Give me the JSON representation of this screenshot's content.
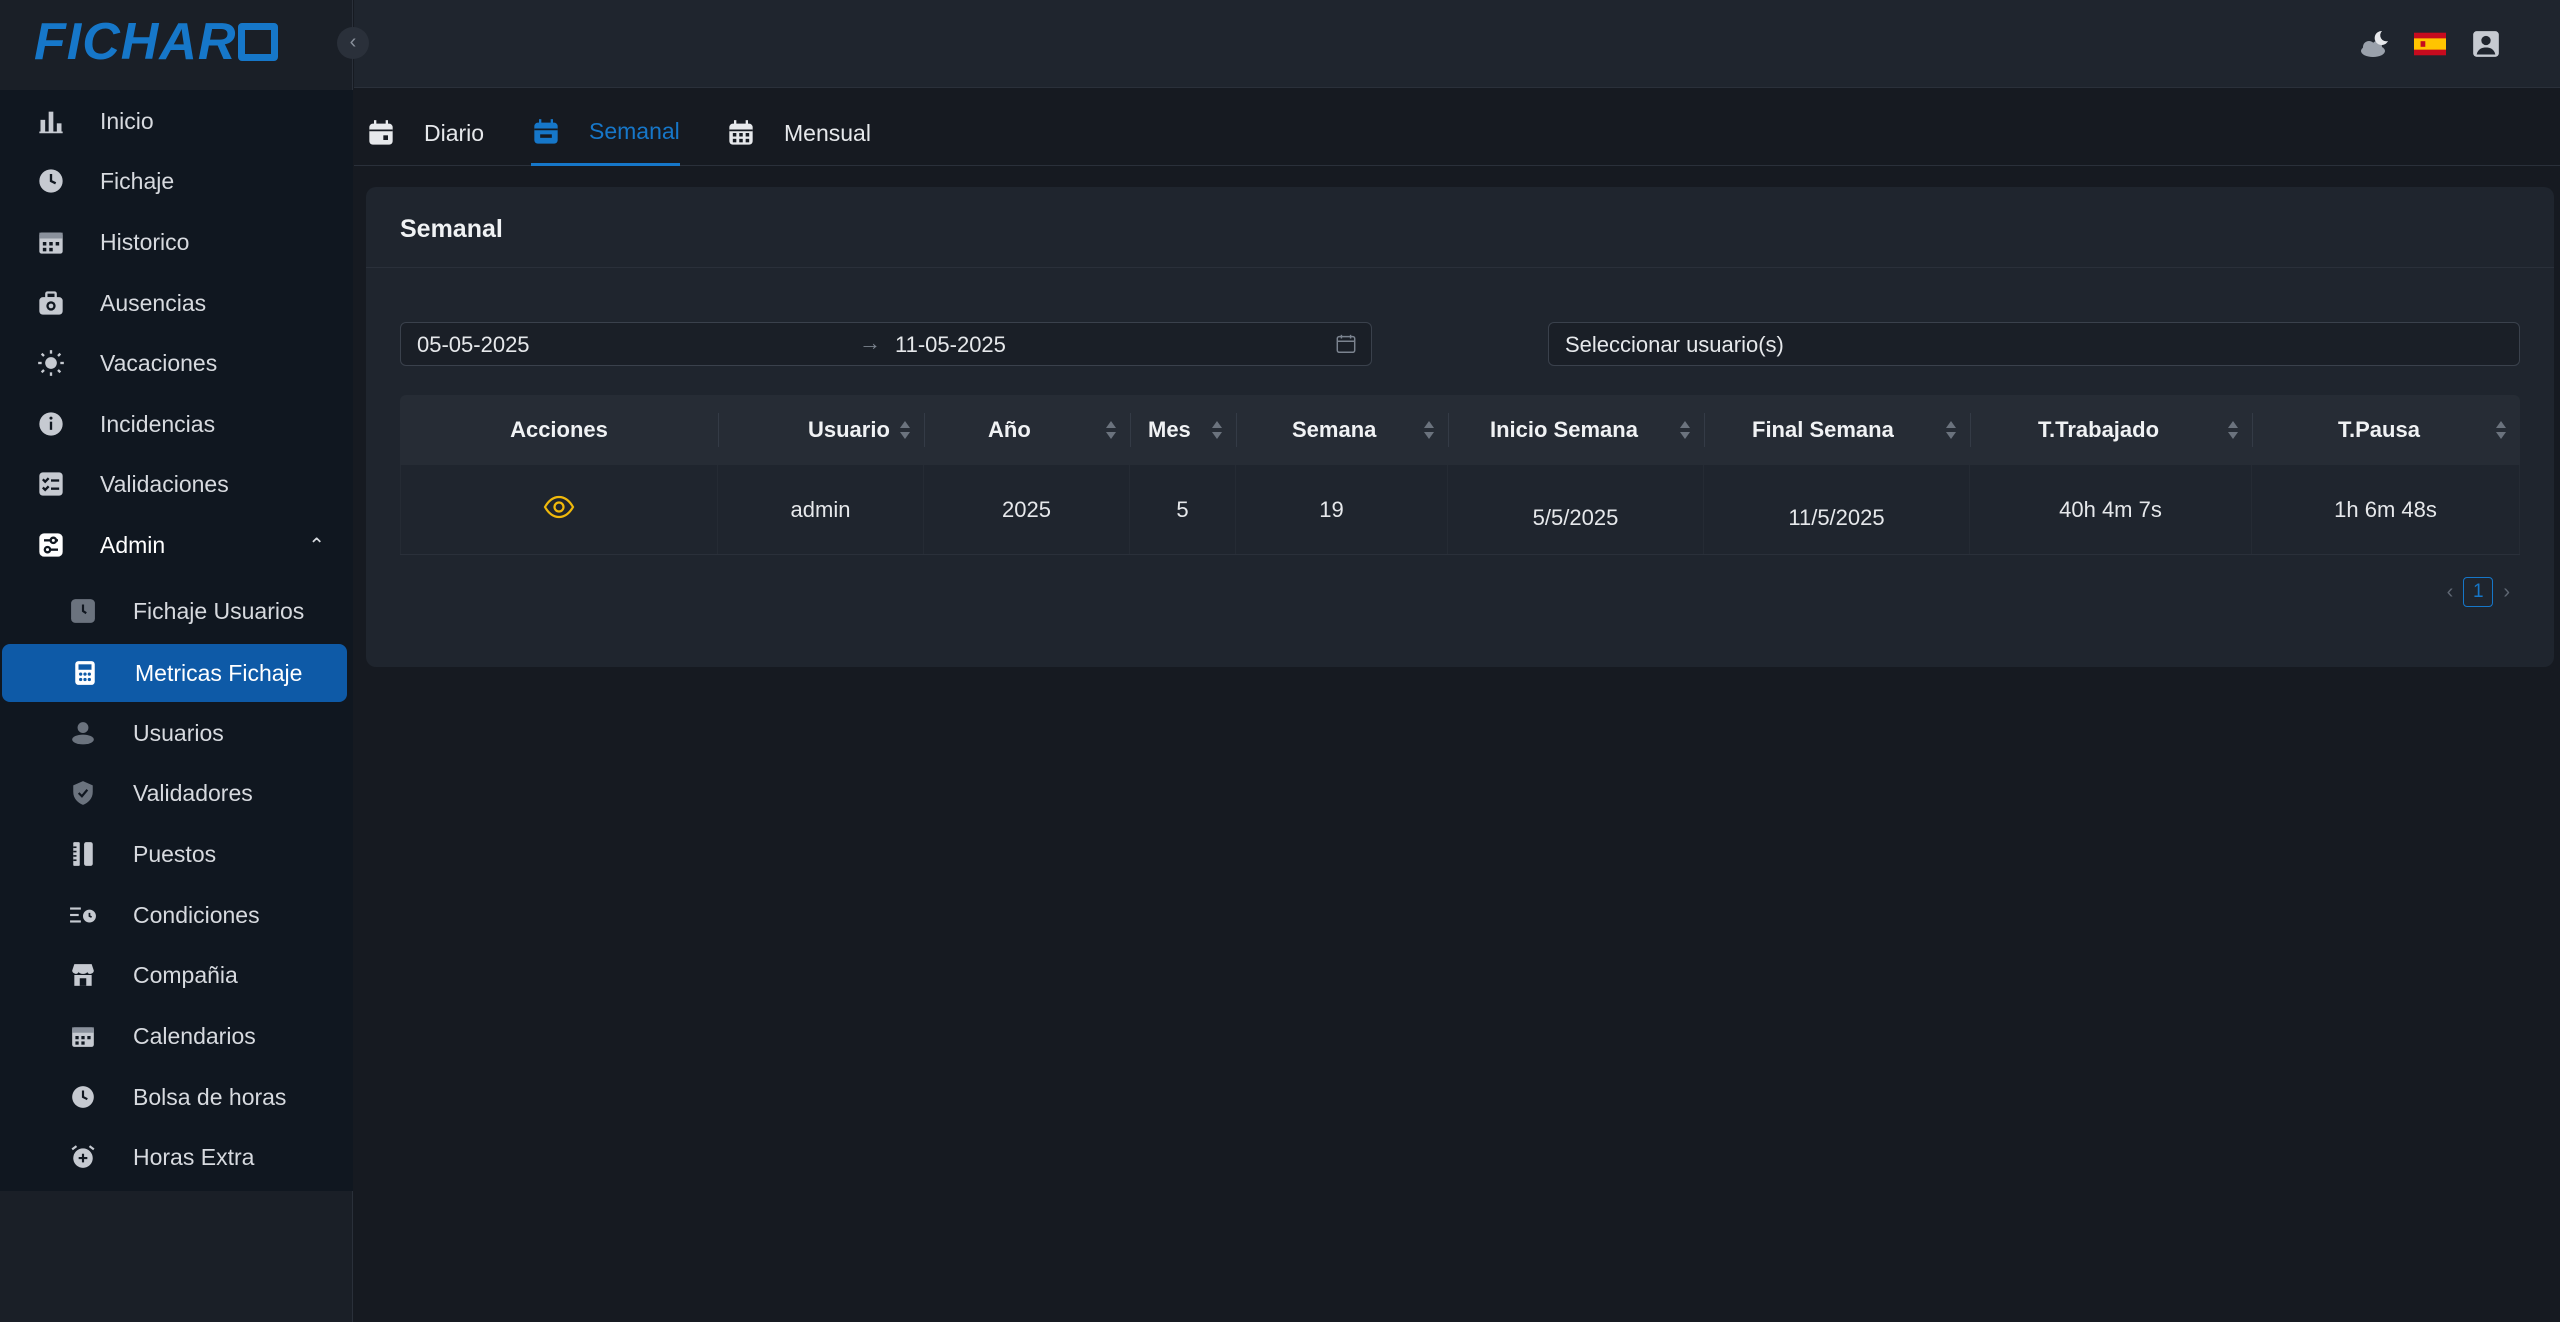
{
  "app": {
    "logo": "FICHAR"
  },
  "sidebar": {
    "items": [
      {
        "label": "Inicio",
        "icon": "bar-chart-icon"
      },
      {
        "label": "Fichaje",
        "icon": "clock-icon"
      },
      {
        "label": "Historico",
        "icon": "calendar-icon"
      },
      {
        "label": "Ausencias",
        "icon": "medical-bag-icon"
      },
      {
        "label": "Vacaciones",
        "icon": "sun-icon"
      },
      {
        "label": "Incidencias",
        "icon": "info-icon"
      },
      {
        "label": "Validaciones",
        "icon": "checklist-icon"
      },
      {
        "label": "Admin",
        "icon": "admin-sliders-icon"
      }
    ],
    "admin_items": [
      {
        "label": "Fichaje Usuarios",
        "icon": "clock-icon"
      },
      {
        "label": "Metricas Fichaje",
        "icon": "calculator-icon"
      },
      {
        "label": "Usuarios",
        "icon": "users-icon"
      },
      {
        "label": "Validadores",
        "icon": "shield-check-icon"
      },
      {
        "label": "Puestos",
        "icon": "tools-icon"
      },
      {
        "label": "Condiciones",
        "icon": "list-clock-icon"
      },
      {
        "label": "Compañia",
        "icon": "store-icon"
      },
      {
        "label": "Calendarios",
        "icon": "calendar-icon"
      },
      {
        "label": "Bolsa de horas",
        "icon": "clock-icon"
      },
      {
        "label": "Horas Extra",
        "icon": "alarm-plus-icon"
      }
    ]
  },
  "tabs": [
    {
      "label": "Diario"
    },
    {
      "label": "Semanal"
    },
    {
      "label": "Mensual"
    }
  ],
  "card": {
    "title": "Semanal",
    "date_start": "05-05-2025",
    "date_end": "11-05-2025",
    "user_placeholder": "Seleccionar usuario(s)"
  },
  "table": {
    "headers": [
      "Acciones",
      "Usuario",
      "Año",
      "Mes",
      "Semana",
      "Inicio Semana",
      "Final Semana",
      "T.Trabajado",
      "T.Pausa"
    ],
    "rows": [
      {
        "usuario": "admin",
        "anio": "2025",
        "mes": "5",
        "semana": "19",
        "inicio": "5/5/2025",
        "final": "11/5/2025",
        "trabajado": "40h 4m 7s",
        "pausa": "1h 6m 48s"
      }
    ]
  },
  "pagination": {
    "current": "1"
  },
  "colors": {
    "accent": "#1677c9",
    "active_nav": "#0e5aa7",
    "eye_icon": "#f0b90b"
  }
}
